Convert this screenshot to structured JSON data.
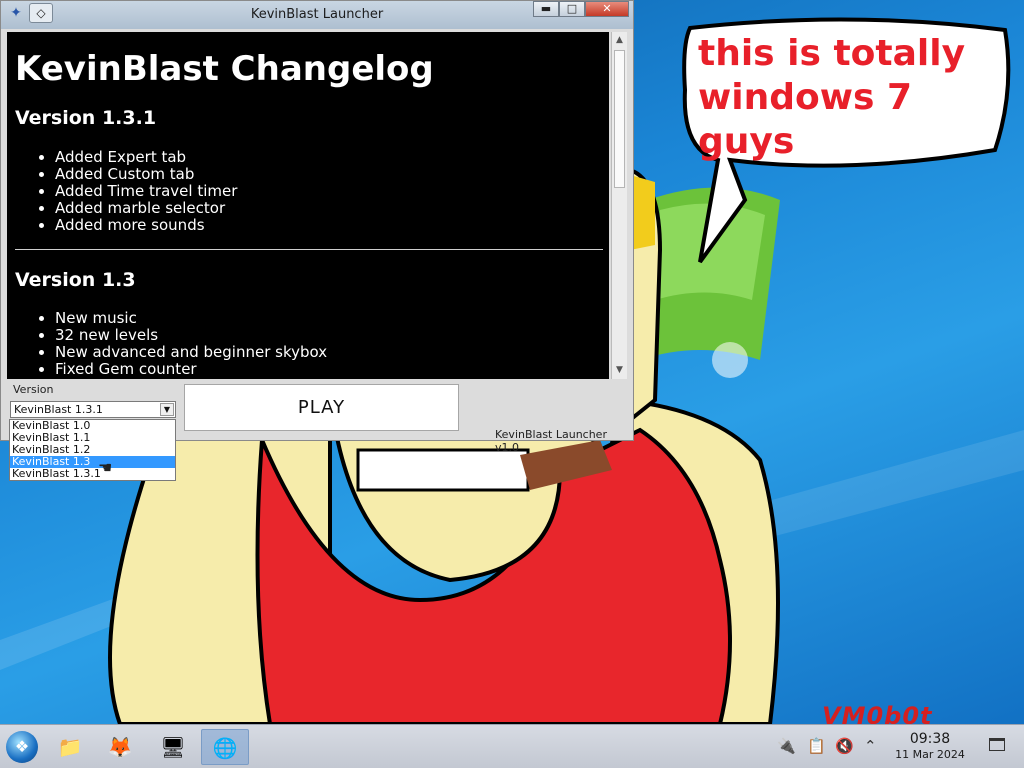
{
  "window": {
    "title": "KevinBlast Launcher",
    "menu_glyph": "◇",
    "controls": {
      "minimize": "▬",
      "maximize": "□",
      "close": "✕"
    }
  },
  "changelog": {
    "heading": "KevinBlast Changelog",
    "sections": [
      {
        "version": "Version 1.3.1",
        "items": [
          "Added Expert tab",
          "Added Custom tab",
          "Added Time travel timer",
          "Added marble selector",
          "Added more sounds"
        ]
      },
      {
        "version": "Version 1.3",
        "items": [
          "New music",
          "32 new levels",
          "New advanced and beginner skybox",
          "Fixed Gem counter"
        ]
      }
    ]
  },
  "version_picker": {
    "label": "Version",
    "selected": "KevinBlast 1.3.1",
    "options": [
      "KevinBlast 1.0",
      "KevinBlast 1.1",
      "KevinBlast 1.2",
      "KevinBlast 1.3",
      "KevinBlast 1.3.1"
    ],
    "highlighted": "KevinBlast 1.3"
  },
  "play_button": "PLAY",
  "footer": "KevinBlast Launcher v1.0",
  "desktop": {
    "speech_bubble": "this is totally windows 7 guys",
    "watermark": "VM0b0t"
  },
  "taskbar": {
    "pinned": [
      "start-orb",
      "file-manager",
      "firefox",
      "control-panel",
      "kevinblast-launcher"
    ],
    "active": "kevinblast-launcher",
    "clock_time": "09:38",
    "clock_date": "11 Mar 2024"
  },
  "colors": {
    "speech_text": "#e8202a",
    "highlight": "#3399ff",
    "changelog_bg": "#000000"
  }
}
